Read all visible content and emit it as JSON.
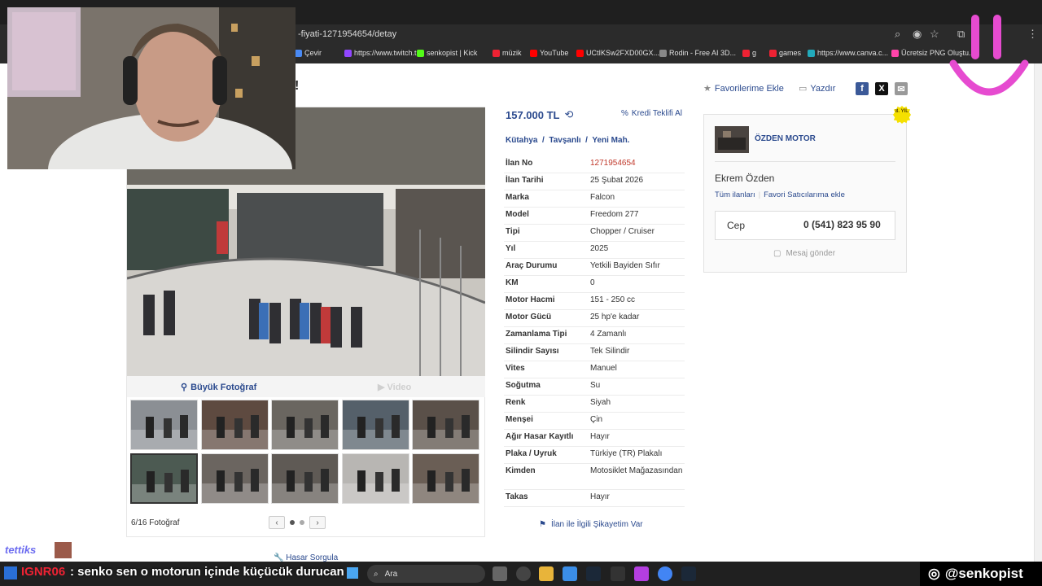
{
  "browser": {
    "url": "-fiyati-1271954654/detay",
    "bookmarks": [
      {
        "label": "Çevir",
        "color": "#4a8af4"
      },
      {
        "label": "https://www.twitch.t...",
        "color": "#9146ff"
      },
      {
        "label": "senkopist | Kick",
        "color": "#53fc18"
      },
      {
        "label": "müzik",
        "color": "#e23"
      },
      {
        "label": "YouTube",
        "color": "#f00"
      },
      {
        "label": "UCtIKSw2FXD00GX...",
        "color": "#f00"
      },
      {
        "label": "Rodin - Free AI 3D...",
        "color": "#888"
      },
      {
        "label": "g",
        "color": "#e23"
      },
      {
        "label": "games",
        "color": "#e23"
      },
      {
        "label": "https://www.canva.c...",
        "color": "#2ab"
      },
      {
        "label": "Ücretsiz PNG Oluştu...",
        "color": "#f4a"
      }
    ]
  },
  "header": {
    "exclaim": "!",
    "favorites": "Favorilerime Ekle",
    "print": "Yazdır"
  },
  "photos": {
    "big_photo_label": "Büyük Fotoğraf",
    "video_label": "Video",
    "count": "6/16 Fotoğraf",
    "active_index": 5
  },
  "listing": {
    "price": "157.000 TL",
    "credit_offer": "Kredi Teklifi Al",
    "location": "Kütahya  /  Tavşanlı  /  Yeni Mah.",
    "specs": [
      {
        "key": "İlan No",
        "value": "1271954654",
        "highlight": true
      },
      {
        "key": "İlan Tarihi",
        "value": "25 Şubat 2026"
      },
      {
        "key": "Marka",
        "value": "Falcon"
      },
      {
        "key": "Model",
        "value": "Freedom 277"
      },
      {
        "key": "Tipi",
        "value": "Chopper / Cruiser"
      },
      {
        "key": "Yıl",
        "value": "2025"
      },
      {
        "key": "Araç Durumu",
        "value": "Yetkili Bayiden Sıfır"
      },
      {
        "key": "KM",
        "value": "0"
      },
      {
        "key": "Motor Hacmi",
        "value": "151 - 250 cc"
      },
      {
        "key": "Motor Gücü",
        "value": "25 hp'e kadar"
      },
      {
        "key": "Zamanlama Tipi",
        "value": "4 Zamanlı"
      },
      {
        "key": "Silindir Sayısı",
        "value": "Tek Silindir"
      },
      {
        "key": "Vites",
        "value": "Manuel"
      },
      {
        "key": "Soğutma",
        "value": "Su"
      },
      {
        "key": "Renk",
        "value": "Siyah"
      },
      {
        "key": "Menşei",
        "value": "Çin"
      },
      {
        "key": "Ağır Hasar Kayıtlı",
        "value": "Hayır"
      },
      {
        "key": "Plaka / Uyruk",
        "value": "Türkiye (TR) Plakalı"
      },
      {
        "key": "Kimden",
        "value": "Motosiklet Mağazasından"
      },
      {
        "key": "Takas",
        "value": "Hayır"
      }
    ],
    "report": "İlan ile İlgili Şikayetim Var",
    "damage_query": "Hasar Sorgula"
  },
  "seller": {
    "badge": "8. YIL",
    "store": "ÖZDEN MOTOR",
    "name": "Ekrem Özden",
    "all_listings": "Tüm ilanları",
    "favorite_sellers": "Favori Satıcılarıma ekle",
    "phone_label": "Cep",
    "phone": "0 (541) 823 95 90",
    "message": "Mesaj gönder"
  },
  "overlay": {
    "chat_user": "tettiks",
    "chat_msg_user": "IGNR06",
    "chat_message": ": senko sen o motorun içinde küçücük durucan",
    "instagram": "@senkopist"
  },
  "taskbar": {
    "search": "Ara"
  },
  "colors": {
    "link": "#2b4a8e",
    "highlight": "#c0392b",
    "chrome_dark": "#2b2b2b"
  }
}
